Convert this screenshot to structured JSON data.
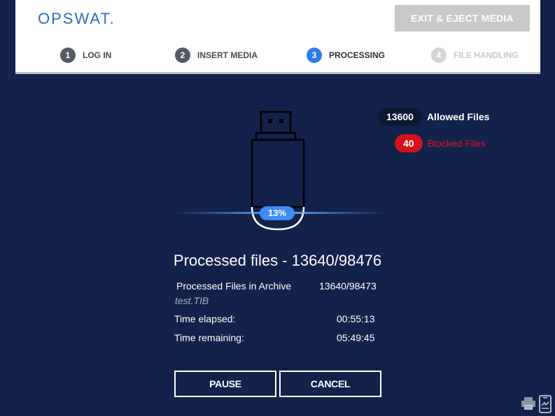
{
  "header": {
    "logo": "OPSWAT",
    "logo_dot": ".",
    "exit_button_label": "EXIT & EJECT MEDIA",
    "steps": [
      {
        "number": "1",
        "label": "LOG IN",
        "state": "done"
      },
      {
        "number": "2",
        "label": "INSERT MEDIA",
        "state": "done"
      },
      {
        "number": "3",
        "label": "PROCESSING",
        "state": "active"
      },
      {
        "number": "4",
        "label": "FILE HANDLING",
        "state": "disabled"
      }
    ]
  },
  "counters": {
    "allowed_count": "13600",
    "allowed_label": "Allowed Files",
    "blocked_count": "40",
    "blocked_label": "Blocked Files"
  },
  "progress": {
    "percent_label": "13%",
    "percent": 13
  },
  "status": {
    "title": "Processed files - 13640/98476",
    "archive_label": "Processed Files in Archive",
    "archive_value": "13640/98473",
    "archive_file": "test.TIB",
    "elapsed_label": "Time elapsed:",
    "elapsed_value": "00:55:13",
    "remaining_label": "Time remaining:",
    "remaining_value": "05:49:45"
  },
  "actions": {
    "pause_label": "PAUSE",
    "cancel_label": "CANCEL"
  },
  "icons": {
    "usb": "usb-drive-icon",
    "print": "printer-icon",
    "eject": "phone-rotate-icon"
  },
  "colors": {
    "background": "#13224a",
    "accent": "#2f7be8",
    "blocked": "#d2131d",
    "disabled_button": "#c9c9c9"
  }
}
